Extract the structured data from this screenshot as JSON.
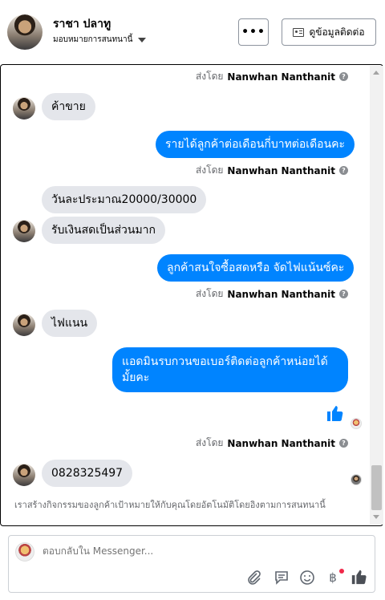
{
  "header": {
    "name": "ราชา ปลาทู",
    "assign_label": "มอบหมายการสนทนานี้",
    "more_label": "•••",
    "contact_label": "ดูข้อมูลติดต่อ"
  },
  "sent_by": {
    "prefix": "ส่งโดย",
    "agent": "Nanwhan Nanthanit"
  },
  "messages": [
    {
      "from": "customer",
      "text": "ค้าขาย"
    },
    {
      "from": "page",
      "text": "รายได้ลูกค้าต่อเดือนกี่บาทต่อเดือนคะ"
    },
    {
      "from": "customer",
      "text": "วันละประมาณ20000/30000"
    },
    {
      "from": "customer",
      "text": "รับเงินสดเป็นส่วนมาก"
    },
    {
      "from": "page",
      "text": "ลูกค้าสนใจซื้อสดหรือ จัดไฟแน้นซ์คะ"
    },
    {
      "from": "customer",
      "text": "ไฟแนน"
    },
    {
      "from": "page",
      "text": "แอดมินรบกวนขอเบอร์ติดต่อลูกค้าหน่อยได้มั้ยคะ"
    },
    {
      "from": "page",
      "text": "👍"
    },
    {
      "from": "customer",
      "text": "0828325497"
    }
  ],
  "footer_note": "เราสร้างกิจกรรมของลูกค้าเป้าหมายให้กับคุณโดยอัตโนมัติโดยอิงตามการสนทนานี้",
  "composer": {
    "placeholder": "ตอบกลับใน Messenger..."
  },
  "colors": {
    "outgoing_bubble": "#0084ff",
    "incoming_bubble": "#e4e6eb",
    "like": "#0084ff"
  }
}
